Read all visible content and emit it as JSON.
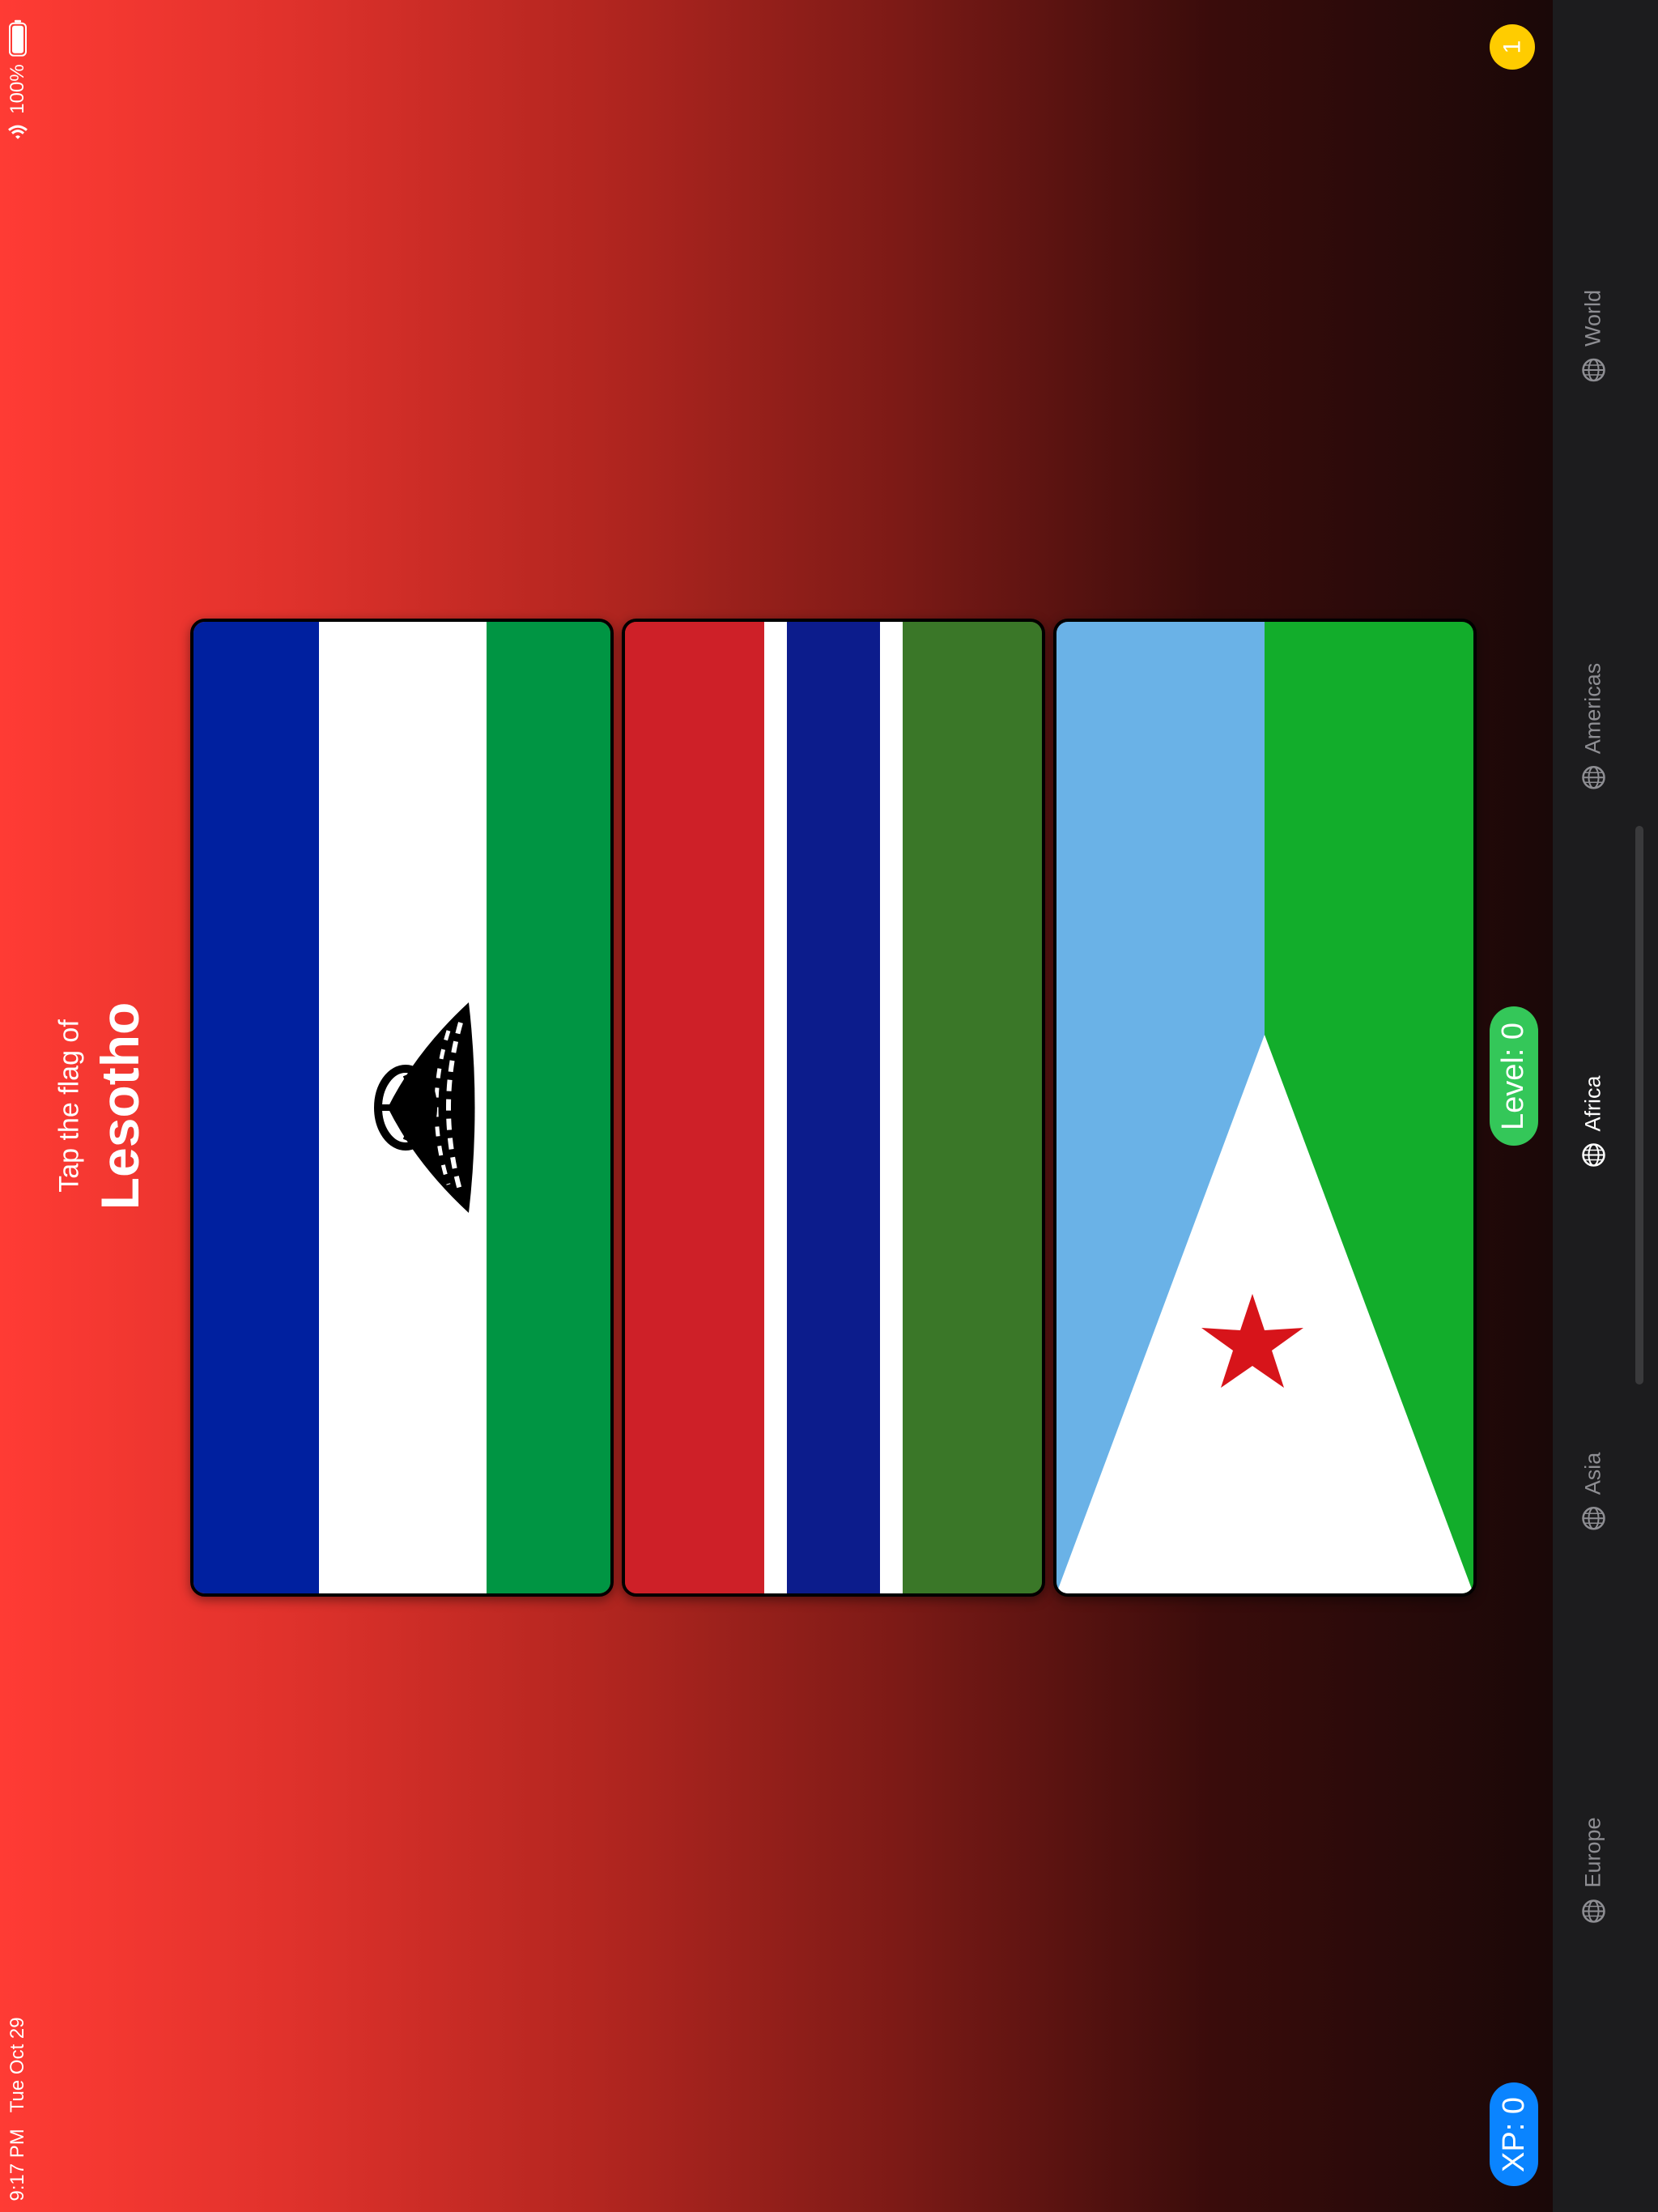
{
  "status_bar": {
    "time": "9:17 PM",
    "date": "Tue Oct 29",
    "battery": "100%"
  },
  "prompt": {
    "instruction": "Tap the flag of",
    "country": "Lesotho"
  },
  "badges": {
    "level": "Level: 0",
    "xp": "XP: 0",
    "coin": "1"
  },
  "tabs": [
    {
      "label": "World",
      "icon": "globe-icon",
      "active": false
    },
    {
      "label": "Americas",
      "icon": "globe-icon",
      "active": false
    },
    {
      "label": "Africa",
      "icon": "globe-icon",
      "active": true
    },
    {
      "label": "Asia",
      "icon": "globe-icon",
      "active": false
    },
    {
      "label": "Europe",
      "icon": "globe-icon",
      "active": false
    }
  ],
  "flags": [
    {
      "country_flag": "Lesotho",
      "colors": [
        "#00209f",
        "#ffffff",
        "#009543"
      ]
    },
    {
      "country_flag": "Gambia",
      "colors": [
        "#ce2028",
        "#ffffff",
        "#0c1c8c",
        "#3a7728"
      ]
    },
    {
      "country_flag": "Djibouti",
      "colors": [
        "#6ab2e7",
        "#12ad2b",
        "#ffffff",
        "#d7141a"
      ]
    }
  ],
  "colors": {
    "level_badge": "#34c759",
    "xp_badge": "#0a84ff",
    "coin": "#ffcc00"
  }
}
